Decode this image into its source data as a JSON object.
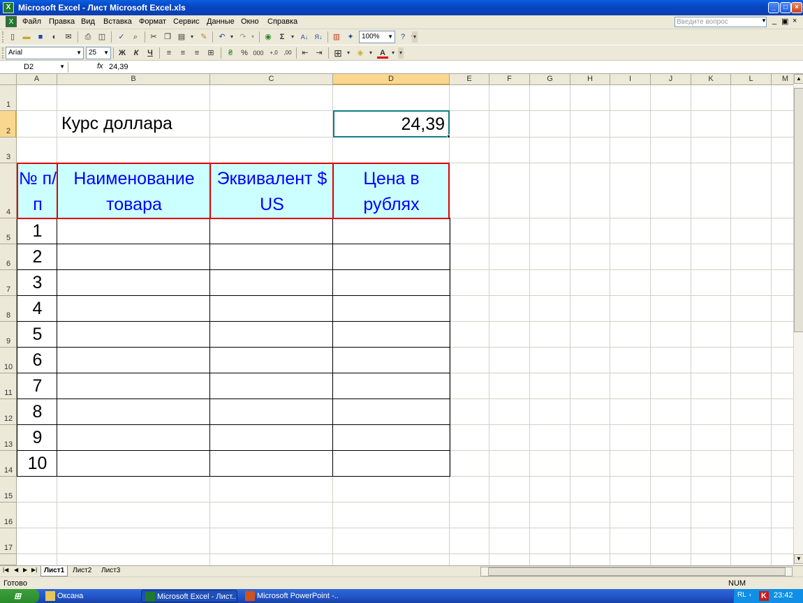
{
  "window": {
    "title": "Microsoft Excel - Лист Microsoft Excel.xls"
  },
  "menu": {
    "items": [
      "Файл",
      "Правка",
      "Вид",
      "Вставка",
      "Формат",
      "Сервис",
      "Данные",
      "Окно",
      "Справка"
    ],
    "help_placeholder": "Введите вопрос"
  },
  "toolbar": {
    "zoom": "100%",
    "font": "Arial",
    "font_size": "25"
  },
  "formula_bar": {
    "cell_ref": "D2",
    "fx": "fx",
    "value": "24,39"
  },
  "columns": [
    "A",
    "B",
    "C",
    "D",
    "E",
    "F",
    "G",
    "H",
    "I",
    "J",
    "K",
    "L",
    "M"
  ],
  "rows": [
    "1",
    "2",
    "3",
    "4",
    "5",
    "6",
    "7",
    "8",
    "9",
    "10",
    "11",
    "12",
    "13",
    "14",
    "15",
    "16",
    "17"
  ],
  "sheet": {
    "title_label": "Курс доллара",
    "rate_value": "24,39",
    "header": {
      "col1": "№ п/п",
      "col2": "Наименование товара",
      "col3": "Эквивалент $ US",
      "col4": "Цена в рублях"
    },
    "numbers": [
      "1",
      "2",
      "3",
      "4",
      "5",
      "6",
      "7",
      "8",
      "9",
      "10"
    ]
  },
  "sheet_tabs": [
    "Лист1",
    "Лист2",
    "Лист3"
  ],
  "status": {
    "left": "Готово",
    "right": "NUM"
  },
  "taskbar": {
    "tasks": [
      "Оксана",
      "Microsoft Excel - Лист...",
      "Microsoft PowerPoint -..."
    ],
    "lang": "RL",
    "clock": "23:42"
  }
}
